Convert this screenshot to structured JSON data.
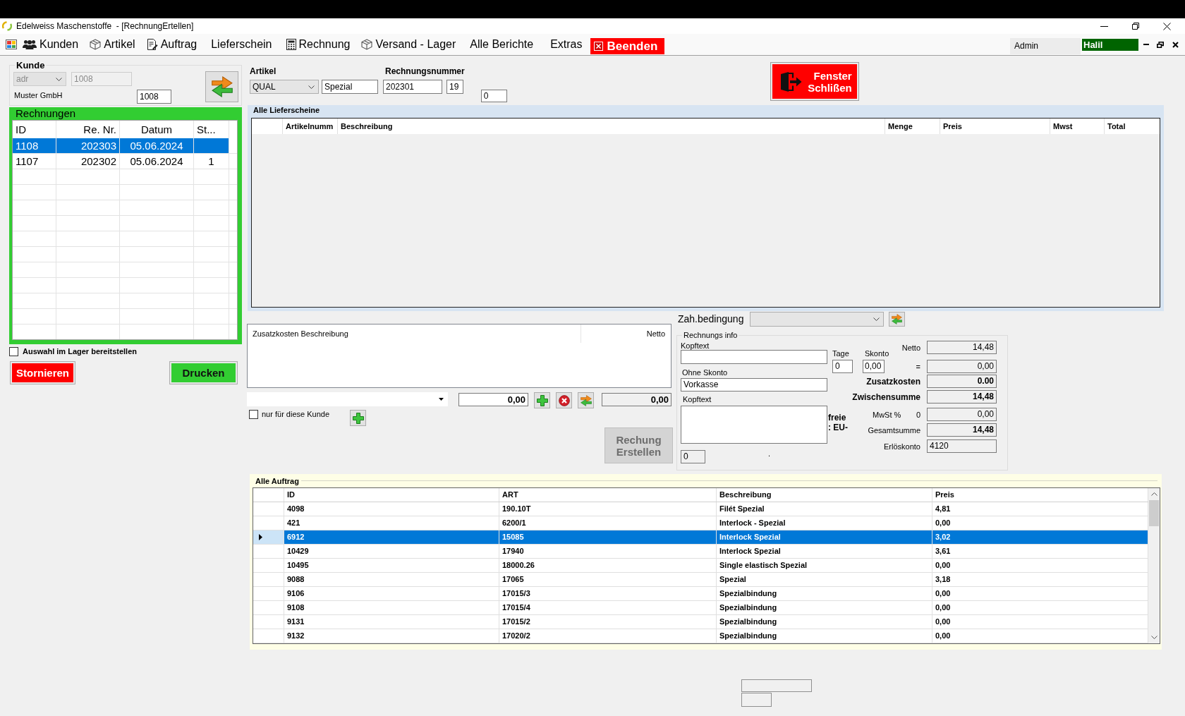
{
  "window": {
    "title": "Edelweiss Maschenstoffe  - [RechnungErtellen]"
  },
  "menu": [
    {
      "label": "Kunden",
      "kind": "item"
    },
    {
      "label": "Artikel",
      "kind": "item"
    },
    {
      "label": "Auftrag",
      "kind": "item"
    },
    {
      "label": "Lieferschein",
      "kind": "item"
    },
    {
      "label": "Rechnung",
      "kind": "item"
    },
    {
      "label": "Versand - Lager",
      "kind": "item"
    },
    {
      "label": "Alle Berichte",
      "kind": "item"
    },
    {
      "label": "Extras",
      "kind": "item"
    },
    {
      "label": "Beenden",
      "kind": "exit"
    }
  ],
  "user": {
    "role": "Admin",
    "name": "Halil"
  },
  "customer": {
    "title": "Kunde",
    "address_type": {
      "value": "adr",
      "disabled": true
    },
    "customer_id": {
      "value": "1008",
      "disabled": true
    },
    "name": "Muster GmbH",
    "number": "1008"
  },
  "invoices": {
    "title": "Rechnungen",
    "columns": [
      "ID",
      "Re. Nr.",
      "Datum",
      "St..."
    ],
    "rows": [
      {
        "id": "1108",
        "re_nr": "202303",
        "datum": "05.06.2024",
        "selected": true
      },
      {
        "id": "1107",
        "re_nr": "202302",
        "datum": "05.06.2024",
        "column_4": "1",
        "selected": false
      }
    ]
  },
  "stock_option": {
    "label": "Auswahl im Lager bereitstellen",
    "checked": false
  },
  "cancel_button": "Stornieren",
  "print_button": "Drucken",
  "article": {
    "label": "Artikel",
    "category": "QUAL",
    "name": "Spezial"
  },
  "invoice_number": {
    "label": "Rechnungsnummer",
    "number": "202301",
    "suffix": "19"
  },
  "side_field": "0",
  "close_button": "Fenster Schlißen",
  "delivery_notes": {
    "title": "Alle Lieferscheine",
    "columns": [
      "Artikelnumm",
      "Beschreibung",
      "Menge",
      "Preis",
      "Mwst",
      "Total"
    ]
  },
  "extra_costs": {
    "columns": [
      "Zusatzkosten Beschreibung",
      "Netto"
    ],
    "amount": "0,00",
    "sum": "0,00",
    "customer_only": {
      "label": "nur für diese Kunde",
      "checked": false
    }
  },
  "create_button": {
    "label": "Rechung Erstellen",
    "disabled": true
  },
  "payment_terms": {
    "label": "Zah.bedingung"
  },
  "invoice_info": {
    "title": "Rechnungs info",
    "header_text_label": "Kopftext",
    "no_discount_label": "Ohne Skonto",
    "no_discount_text": "Vorkasse",
    "footer_text_label": "Kopftext",
    "small_field": "0",
    "dot_label": ".",
    "days_label": "Tage",
    "days": "0",
    "discount_label": "Skonto",
    "discount": "0,00",
    "partial_label_lines": [
      "freie",
      ": EU-"
    ],
    "totals": [
      {
        "label": "Netto",
        "value": "14,48",
        "kind": "plain"
      },
      {
        "label": "=",
        "value": "0,00",
        "kind": "plain"
      },
      {
        "label": "Zusatzkosten",
        "value": "0.00",
        "kind": "strong"
      },
      {
        "label": "Zwischensumme",
        "value": "14,48",
        "kind": "strong"
      },
      {
        "label": "MwSt %",
        "rate": "0",
        "value": "0,00",
        "kind": "plain"
      },
      {
        "label": "Gesamtsumme",
        "value": "14,48",
        "kind": "total"
      },
      {
        "label": "Erlöskonto",
        "value": "4120",
        "kind": "account"
      }
    ]
  },
  "orders": {
    "title": "Alle Auftrag",
    "columns": [
      "ID",
      "ART",
      "Beschreibung",
      "Preis"
    ],
    "rows": [
      {
        "cells": [
          "4098",
          "190.10T",
          "Filét Spezial",
          "4,81"
        ],
        "selected": false
      },
      {
        "cells": [
          "421",
          "6200/1",
          "Interlock - Spezial",
          "0,00"
        ],
        "selected": false
      },
      {
        "cells": [
          "6912",
          "15085",
          "Interlock Spezial",
          "3,02"
        ],
        "selected": true
      },
      {
        "cells": [
          "10429",
          "17940",
          "Interlock Spezial",
          "3,61"
        ],
        "selected": false
      },
      {
        "cells": [
          "10495",
          "18000.26",
          "Single elastisch Spezial",
          "0,00"
        ],
        "selected": false
      },
      {
        "cells": [
          "9088",
          "17065",
          "Spezial",
          "3,18"
        ],
        "selected": false
      },
      {
        "cells": [
          "9106",
          "17015/3",
          "Spezialbindung",
          "0,00"
        ],
        "selected": false
      },
      {
        "cells": [
          "9108",
          "17015/4",
          "Spezialbindung",
          "0,00"
        ],
        "selected": false
      },
      {
        "cells": [
          "9131",
          "17015/2",
          "Spezialbindung",
          "0,00"
        ],
        "selected": false
      },
      {
        "cells": [
          "9132",
          "17020/2",
          "Spezialbindung",
          "0,00"
        ],
        "selected": false
      }
    ]
  }
}
